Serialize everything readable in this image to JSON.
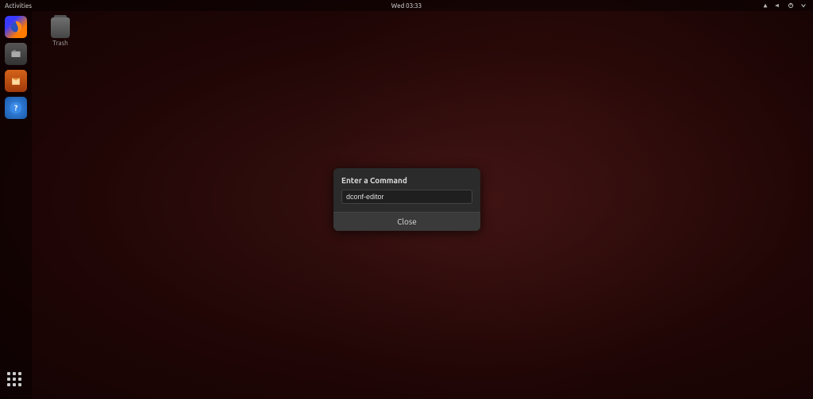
{
  "topbar": {
    "activities_label": "Activities",
    "clock": "Wed 03:33"
  },
  "dock": {
    "items": [
      {
        "name": "firefox"
      },
      {
        "name": "files"
      },
      {
        "name": "software"
      },
      {
        "name": "help"
      }
    ]
  },
  "desktop": {
    "trash_label": "Trash"
  },
  "dialog": {
    "title": "Enter a Command",
    "input_value": "dconf-editor",
    "close_label": "Close"
  }
}
